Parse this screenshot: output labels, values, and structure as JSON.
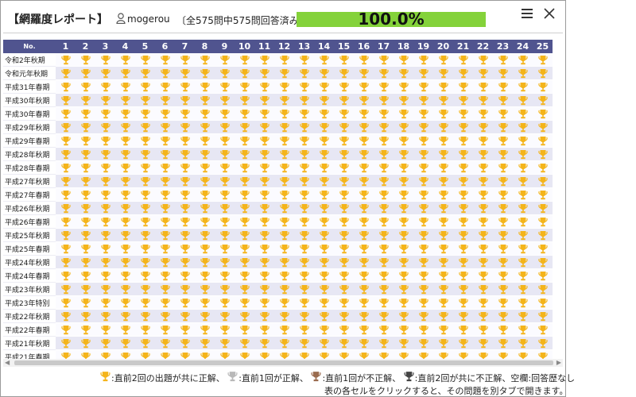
{
  "header": {
    "title": "【網羅度レポート】",
    "username": "mogerou",
    "summary": "〔全575問中575問回答済み〕",
    "progress_text": "100.0%",
    "progress_value": 1.0,
    "progress_color": "#84d23a"
  },
  "icons": {
    "user": "user-icon",
    "menu": "menu-icon",
    "close": "close-icon",
    "trophy": "trophy-icon"
  },
  "table": {
    "corner_label": "No.",
    "header_color": "#50548f",
    "columns": [
      "1",
      "2",
      "3",
      "4",
      "5",
      "6",
      "7",
      "8",
      "9",
      "10",
      "11",
      "12",
      "13",
      "14",
      "15",
      "16",
      "17",
      "18",
      "19",
      "20",
      "21",
      "22",
      "23",
      "24",
      "25"
    ],
    "rows": [
      "令和2年秋期",
      "令和元年秋期",
      "平成31年春期",
      "平成30年秋期",
      "平成30年春期",
      "平成29年秋期",
      "平成29年春期",
      "平成28年秋期",
      "平成28年春期",
      "平成27年秋期",
      "平成27年春期",
      "平成26年秋期",
      "平成26年春期",
      "平成25年秋期",
      "平成25年春期",
      "平成24年秋期",
      "平成24年春期",
      "平成23年秋期",
      "平成23年特別",
      "平成22年秋期",
      "平成22年春期",
      "平成21年秋期",
      "平成21年春期"
    ],
    "cell_status": "gold"
  },
  "legend": {
    "gold": ":直前2回の出題が共に正解、",
    "silver": ":直前1回が正解、",
    "bronze": ":直前1回が不正解、",
    "black": ":直前2回が共に不正解、空欄:回答歴なし"
  },
  "colors": {
    "gold": "#f4b41a",
    "silver": "#b9b9b9",
    "bronze": "#9a6b4e",
    "black": "#444444"
  },
  "hint": "表の各セルをクリックすると、その問題を別タブで開きます。"
}
